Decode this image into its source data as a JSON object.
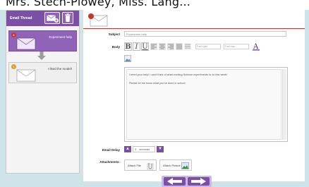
{
  "caption": "Mrs. Stech-Plowey, Miss. Lang...",
  "thread": {
    "title": "Email Thread",
    "emails": [
      {
        "badge": "2",
        "subject": "Experiment help",
        "selected": true
      },
      {
        "badge": "1",
        "subject": "I liked the model!",
        "selected": false
      }
    ]
  },
  "form": {
    "subject_label": "Subject",
    "subject_value": "Experiment help",
    "body_label": "Body",
    "font_family_placeholder": "Font style",
    "font_size_placeholder": "Font size",
    "body_lines": [
      "I need your help! I can't think of what exciting Science experiments to do this week!",
      "Please let me know what you've done in school."
    ],
    "delay_label": "Email Delay",
    "delay_value": "3",
    "delay_unit": "seconds",
    "attachments_label": "Attachments:",
    "attach_file_label": "Attach File",
    "attach_picture_label": "Attach Picture"
  },
  "colors": {
    "accent": "#7b4fa6",
    "badge_red": "#c0392b",
    "badge_orange": "#e39b2b"
  },
  "icons": [
    "envelope-icon",
    "trash-icon",
    "arrow-down-icon",
    "bold-icon",
    "italic-icon",
    "underline-icon",
    "align-left-icon",
    "align-center-icon",
    "align-right-icon",
    "justify-icon",
    "list-icon",
    "font-color-icon",
    "insert-image-icon",
    "paperclip-icon",
    "picture-icon",
    "arrow-left-icon",
    "arrow-right-icon"
  ]
}
